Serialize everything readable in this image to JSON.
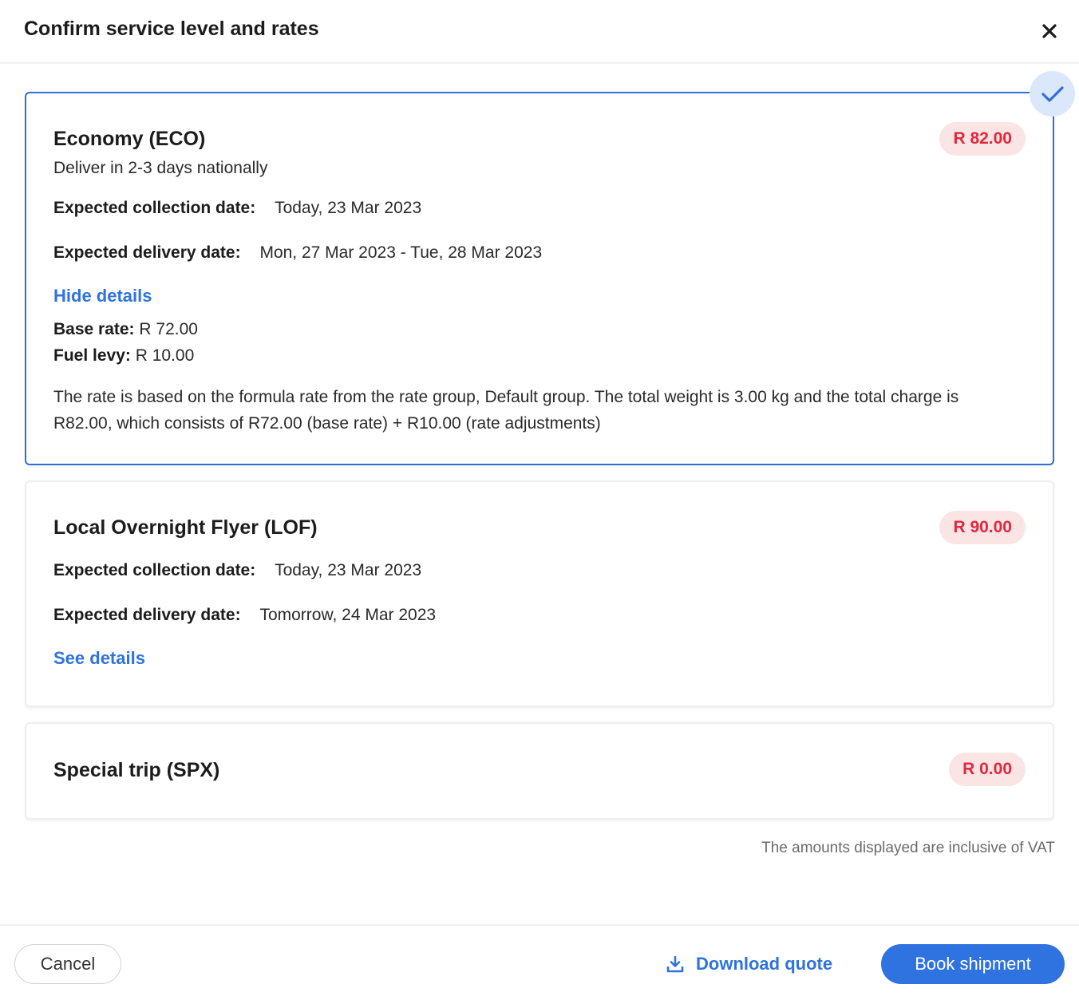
{
  "header": {
    "title": "Confirm service level and rates",
    "close_icon": "close-icon"
  },
  "colors": {
    "accent": "#2f73e0",
    "price_text": "#e0283f",
    "price_bg": "#fbe4e4",
    "selected_border": "#2f6fdb"
  },
  "services": [
    {
      "title": "Economy (ECO)",
      "subtitle": "Deliver in 2-3 days nationally",
      "price": "R 82.00",
      "selected": true,
      "collection_label": "Expected collection date:",
      "collection_value": "Today, 23 Mar 2023",
      "delivery_label": "Expected delivery date:",
      "delivery_value": "Mon, 27 Mar 2023 - Tue, 28 Mar 2023",
      "details_link": "Hide details",
      "base_rate_label": "Base rate:",
      "base_rate_value": "R 72.00",
      "fuel_levy_label": "Fuel levy:",
      "fuel_levy_value": "R 10.00",
      "description": "The rate is based on the formula rate from the rate group, Default group. The total weight is 3.00 kg and the total charge is R82.00, which consists of R72.00 (base rate) + R10.00 (rate adjustments)"
    },
    {
      "title": "Local Overnight Flyer (LOF)",
      "price": "R 90.00",
      "selected": false,
      "collection_label": "Expected collection date:",
      "collection_value": "Today, 23 Mar 2023",
      "delivery_label": "Expected delivery date:",
      "delivery_value": "Tomorrow, 24 Mar 2023",
      "details_link": "See details"
    },
    {
      "title": "Special trip (SPX)",
      "price": "R 0.00",
      "selected": false
    }
  ],
  "vat_note": "The amounts displayed are inclusive of VAT",
  "footer": {
    "cancel_label": "Cancel",
    "download_label": "Download quote",
    "download_icon": "download-icon",
    "book_label": "Book shipment"
  }
}
